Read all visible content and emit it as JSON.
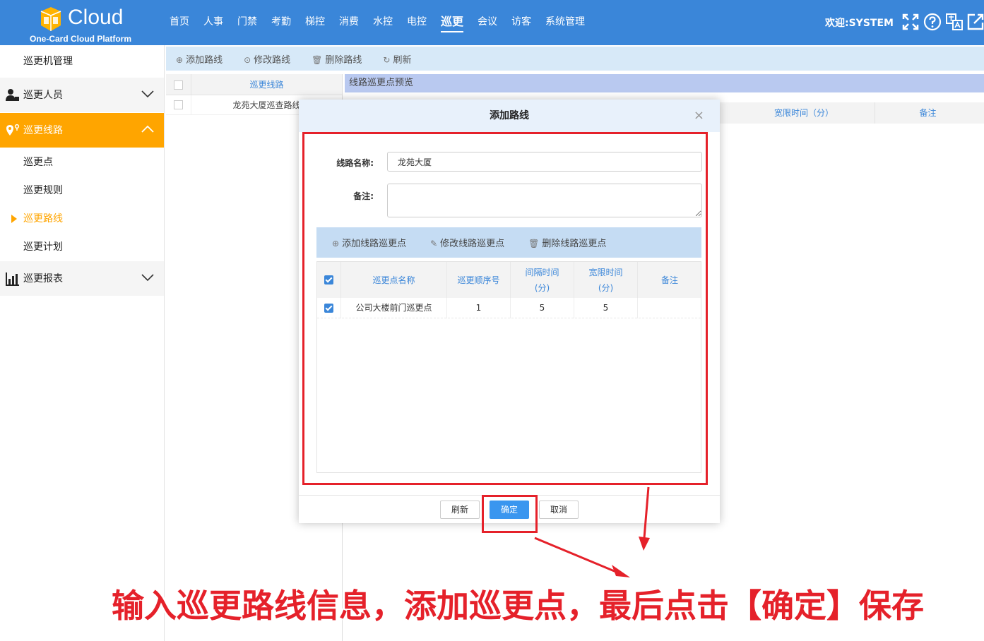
{
  "header": {
    "logo_text": "Cloud",
    "logo_subtitle": "One-Card Cloud Platform",
    "nav": [
      {
        "label": "首页"
      },
      {
        "label": "人事"
      },
      {
        "label": "门禁"
      },
      {
        "label": "考勤"
      },
      {
        "label": "梯控"
      },
      {
        "label": "消费"
      },
      {
        "label": "水控"
      },
      {
        "label": "电控"
      },
      {
        "label": "巡更",
        "active": true
      },
      {
        "label": "会议"
      },
      {
        "label": "访客"
      },
      {
        "label": "系统管理"
      }
    ],
    "welcome": "欢迎:SYSTEM",
    "icons": [
      "fullscreen-icon",
      "help-icon",
      "language-icon",
      "logout-icon"
    ]
  },
  "sidebar": {
    "top_item": "巡更机管理",
    "group_personnel": "巡更人员",
    "group_route": "巡更线路",
    "sub_items": [
      {
        "label": "巡更点"
      },
      {
        "label": "巡更规则"
      },
      {
        "label": "巡更路线",
        "current": true
      },
      {
        "label": "巡更计划"
      }
    ],
    "group_report": "巡更报表"
  },
  "toolbar": {
    "add": "添加路线",
    "edit": "修改路线",
    "delete": "删除路线",
    "refresh": "刷新"
  },
  "route_list": {
    "column": "巡更线路",
    "rows": [
      "龙苑大厦巡查路线"
    ]
  },
  "preview": {
    "title": "线路巡更点预览",
    "col_grace": "宽限时间（分）",
    "col_remark": "备注"
  },
  "modal": {
    "title": "添加路线",
    "close": "×",
    "name_label": "线路名称:",
    "name_value": "龙苑大厦",
    "remark_label": "备注:",
    "remark_value": "",
    "sub_toolbar": {
      "add": "添加线路巡更点",
      "edit": "修改线路巡更点",
      "delete": "删除线路巡更点"
    },
    "grid": {
      "headers": {
        "name": "巡更点名称",
        "order": "巡更顺序号",
        "interval": "间隔时间\n(分)",
        "interval_l1": "间隔时间",
        "interval_l2": "(分)",
        "grace_l1": "宽限时间",
        "grace_l2": "(分)",
        "remark": "备注"
      },
      "rows": [
        {
          "name": "公司大楼前门巡更点",
          "order": "1",
          "interval": "5",
          "grace": "5",
          "remark": ""
        }
      ]
    },
    "buttons": {
      "refresh": "刷新",
      "ok": "确定",
      "cancel": "取消"
    }
  },
  "annotation": {
    "text": "输入巡更路线信息，添加巡更点，最后点击【确定】保存",
    "color": "#e5212a"
  },
  "colors": {
    "header": "#3a86d9",
    "active_group": "#ffa500",
    "primary_button": "#3a96ef"
  }
}
